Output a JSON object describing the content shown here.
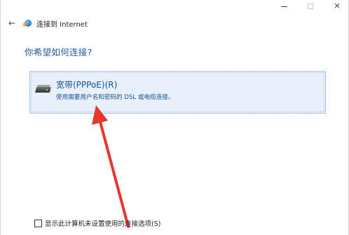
{
  "window": {
    "minimize_glyph": "",
    "maximize_glyph": "",
    "close_glyph": "✕"
  },
  "nav": {
    "back_glyph": "←",
    "title": "连接到 Internet"
  },
  "heading": "你希望如何连接?",
  "option": {
    "title": "宽带(PPPoE)(R)",
    "description": "使用需要用户名和密码的 DSL 或电缆连接。",
    "icon": "modem-icon"
  },
  "checkbox": {
    "label": "显示此计算机未设置使用的连接选项(S)",
    "checked": false
  },
  "annotation": {
    "color": "#e8362c",
    "type": "arrow"
  }
}
